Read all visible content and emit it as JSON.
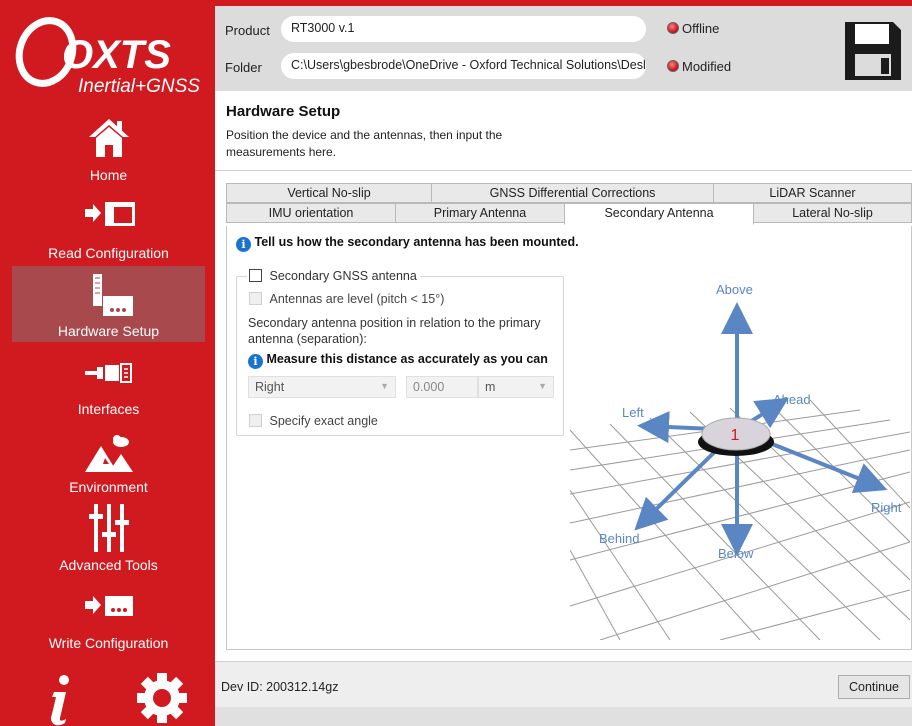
{
  "brand": {
    "name": "OXTS",
    "tagline": "Inertial+GNSS",
    "accent": "#d11a20"
  },
  "sidebar": {
    "items": [
      {
        "label": "Home",
        "icon": "home-icon"
      },
      {
        "label": "Read Configuration",
        "icon": "read-config-icon"
      },
      {
        "label": "Hardware Setup",
        "icon": "hardware-setup-icon",
        "active": true
      },
      {
        "label": "Interfaces",
        "icon": "interfaces-icon"
      },
      {
        "label": "Environment",
        "icon": "environment-icon"
      },
      {
        "label": "Advanced Tools",
        "icon": "sliders-icon"
      },
      {
        "label": "Write Configuration",
        "icon": "write-config-icon"
      }
    ],
    "bottom_icons": [
      "info-icon",
      "gear-icon"
    ]
  },
  "header": {
    "product_label": "Product",
    "product_value": "RT3000 v.1",
    "folder_label": "Folder",
    "folder_value": "C:\\Users\\gbesbrode\\OneDrive - Oxford Technical Solutions\\Desl",
    "status_offline": "Offline",
    "status_modified": "Modified",
    "save_icon": "floppy-disk-icon"
  },
  "page": {
    "title": "Hardware Setup",
    "description": "Position the device and the antennas, then input the measurements here."
  },
  "tabs": {
    "row1": [
      "Vertical No-slip",
      "GNSS Differential Corrections",
      "LiDAR Scanner"
    ],
    "row2": [
      "IMU orientation",
      "Primary Antenna",
      "Secondary Antenna",
      "Lateral No-slip"
    ],
    "active": "Secondary Antenna"
  },
  "content": {
    "heading": "Tell us how the secondary antenna has been mounted.",
    "secondary_gnss_label": "Secondary GNSS antenna",
    "antennas_level_label": "Antennas are level (pitch < 15°)",
    "position_text": "Secondary antenna position in relation to the primary antenna (separation):",
    "measure_note": "Measure this distance as accurately as you can",
    "direction_value": "Right",
    "distance_placeholder": "0.000",
    "unit_value": "m",
    "exact_angle_label": "Specify exact angle"
  },
  "diagram": {
    "labels": {
      "above": "Above",
      "ahead": "Ahead",
      "left": "Left",
      "right": "Right",
      "behind": "Behind",
      "below": "Below"
    },
    "marker": "1",
    "arrow_color": "#5b86c4"
  },
  "footer": {
    "dev_id": "Dev ID: 200312.14gz",
    "continue_label": "Continue"
  }
}
